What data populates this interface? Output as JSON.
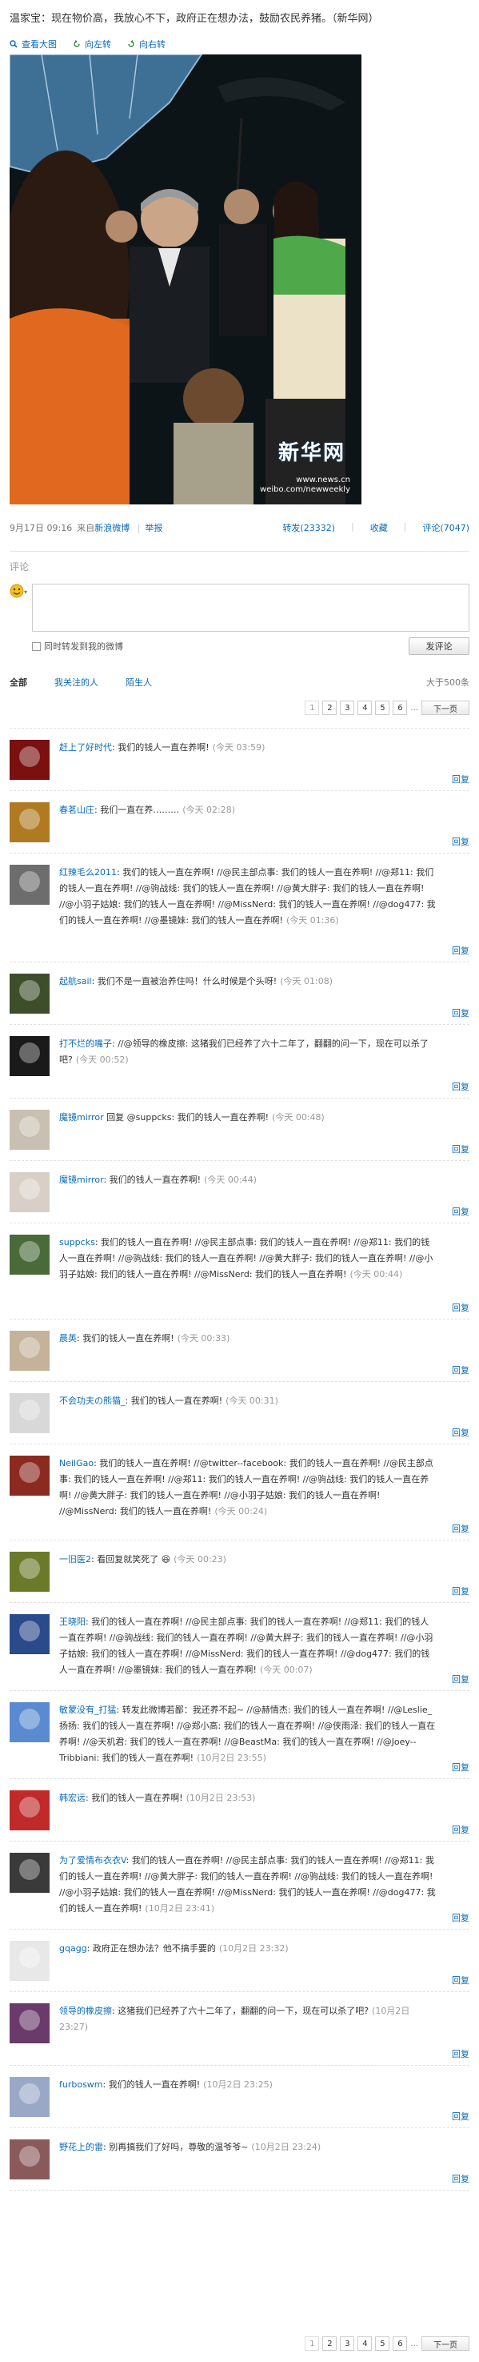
{
  "post": {
    "text": "温家宝：现在物价高，我放心不下，政府正在想办法，鼓励农民养猪。（新华网）"
  },
  "image_tools": [
    {
      "label": "查看大图",
      "icon": "zoom-icon"
    },
    {
      "label": "向左转",
      "icon": "rotate-left-icon"
    },
    {
      "label": "向右转",
      "icon": "rotate-right-icon"
    }
  ],
  "photo": {
    "logo": "新华网",
    "url_line1": "www.news.cn",
    "url_line2": "weibo.com/newweekly"
  },
  "meta": {
    "time": "9月17日 09:16",
    "source_prefix": "来自",
    "source": "新浪微博",
    "report": "举报",
    "forward": "转发(23332)",
    "favorite": "收藏",
    "comment": "评论(7047)"
  },
  "comment_box": {
    "title": "评论",
    "also_forward": "同时转发到我的微博",
    "submit": "发评论"
  },
  "filters": {
    "all": "全部",
    "following": "我关注的人",
    "strangers": "陌生人",
    "total": "大于500条"
  },
  "pager": {
    "pages": [
      "1",
      "2",
      "3",
      "4",
      "5",
      "6"
    ],
    "ellipsis": "...",
    "next": "下一页"
  },
  "reply_label": "回复",
  "colors": {
    "link": "#0a6bb6",
    "border": "#e0e0e0",
    "muted": "#999999"
  },
  "comments": [
    {
      "user": "赶上了好时代",
      "text": ": 我们的钱人一直在养啊!",
      "time": "(今天 03:59)"
    },
    {
      "user": "春茗山庄",
      "text": ": 我们一直在养………",
      "time": "(今天 02:28)"
    },
    {
      "user": "红辣毛么2011",
      "text": ": 我们的钱人一直在养啊! //@民主部点事: 我们的钱人一直在养啊! //@郑11: 我们的钱人一直在养啊! //@驹战线: 我们的钱人一直在养啊! //@黄大胖子: 我们的钱人一直在养啊! //@小羽子姑娘: 我们的钱人一直在养啊! //@MissNerd: 我们的钱人一直在养啊! //@dog477: 我们的钱人一直在养啊! //@墨镜妹: 我们的钱人一直在养啊!",
      "time": "(今天 01:36)"
    },
    {
      "user": "起航sail",
      "text": ": 我们不是一直被治养住吗！什么时候是个头呀!",
      "time": "(今天 01:08)"
    },
    {
      "user": "打不烂的嘴子",
      "text": ": //@领导的橡皮擦: 这猪我们已经养了六十二年了，翻翻的问一下，现在可以杀了吧?",
      "time": "(今天 00:52)"
    },
    {
      "user": "魔镜mirror",
      "text": " 回复 @suppcks: 我们的钱人一直在养啊!",
      "time": "(今天 00:48)"
    },
    {
      "user": "魔镜mirror",
      "text": ": 我们的钱人一直在养啊!",
      "time": "(今天 00:44)"
    },
    {
      "user": "suppcks",
      "text": ": 我们的钱人一直在养啊! //@民主部点事: 我们的钱人一直在养啊! //@郑11: 我们的钱人一直在养啊! //@驹战线: 我们的钱人一直在养啊! //@黄大胖子: 我们的钱人一直在养啊! //@小羽子姑娘: 我们的钱人一直在养啊! //@MissNerd: 我们的钱人一直在养啊!",
      "time": "(今天 00:44)"
    },
    {
      "user": "晨英",
      "text": ": 我们的钱人一直在养啊!",
      "time": "(今天 00:33)"
    },
    {
      "user": "不会功夫の熊猫_",
      "text": ": 我们的钱人一直在养啊!",
      "time": "(今天 00:31)"
    },
    {
      "user": "NeilGao",
      "text": ": 我们的钱人一直在养啊! //@twitter--facebook: 我们的钱人一直在养啊! //@民主部点事: 我们的钱人一直在养啊! //@郑11: 我们的钱人一直在养啊! //@驹战线: 我们的钱人一直在养啊! //@黄大胖子: 我们的钱人一直在养啊! //@小羽子姑娘: 我们的钱人一直在养啊! //@MissNerd: 我们的钱人一直在养啊!",
      "time": "(今天 00:24)"
    },
    {
      "user": "一旧医2",
      "text": ": 看回复就笑死了 😆",
      "time": "(今天 00:23)"
    },
    {
      "user": "王晓阳",
      "text": ": 我们的钱人一直在养啊! //@民主部点事: 我们的钱人一直在养啊! //@郑11: 我们的钱人一直在养啊! //@驹战线: 我们的钱人一直在养啊! //@黄大胖子: 我们的钱人一直在养啊! //@小羽子姑娘: 我们的钱人一直在养啊! //@MissNerd: 我们的钱人一直在养啊! //@dog477: 我们的钱人一直在养啊! //@墨镜妹: 我们的钱人一直在养啊!",
      "time": "(今天 00:07)"
    },
    {
      "user": "敏蒙没有_打猛",
      "text": ": 转发此微博若鄙：我还养不起~ //@赫情杰: 我们的钱人一直在养啊! //@Leslie_扬扬: 我们的钱人一直在养啊! //@郑小高: 我们的钱人一直在养啊! //@侠雨泽: 我们的钱人一直在养啊! //@天机君: 我们的钱人一直在养啊! //@BeastMa: 我们的钱人一直在养啊! //@Joey--Tribbiani: 我们的钱人一直在养啊!",
      "time": "(10月2日 23:55)"
    },
    {
      "user": "韩宏远",
      "text": ": 我们的钱人一直在养啊!",
      "time": "(10月2日 23:53)"
    },
    {
      "user": "为了爱情布衣衣V",
      "text": ": 我们的钱人一直在养啊! //@民主部点事: 我们的钱人一直在养啊! //@郑11: 我们的钱人一直在养啊! //@黄大胖子: 我们的钱人一直在养啊! //@驹战线: 我们的钱人一直在养啊! //@小羽子姑娘: 我们的钱人一直在养啊! //@MissNerd: 我们的钱人一直在养啊! //@dog477: 我们的钱人一直在养啊!",
      "time": "(10月2日 23:41)"
    },
    {
      "user": "gqagg",
      "text": ": 政府正在想办法？他不搞手要的",
      "time": "(10月2日 23:32)"
    },
    {
      "user": "领导的橡皮擦",
      "text": ": 这猪我们已经养了六十二年了，翻翻的问一下，现在可以杀了吧?",
      "time": "(10月2日 23:27)"
    },
    {
      "user": "furboswm",
      "text": ": 我们的钱人一直在养啊!",
      "time": "(10月2日 23:25)"
    },
    {
      "user": "野花上的雷",
      "text": ": 别再搞我们了好吗，尊敬的温爷爷~",
      "time": "(10月2日 23:24)"
    }
  ]
}
